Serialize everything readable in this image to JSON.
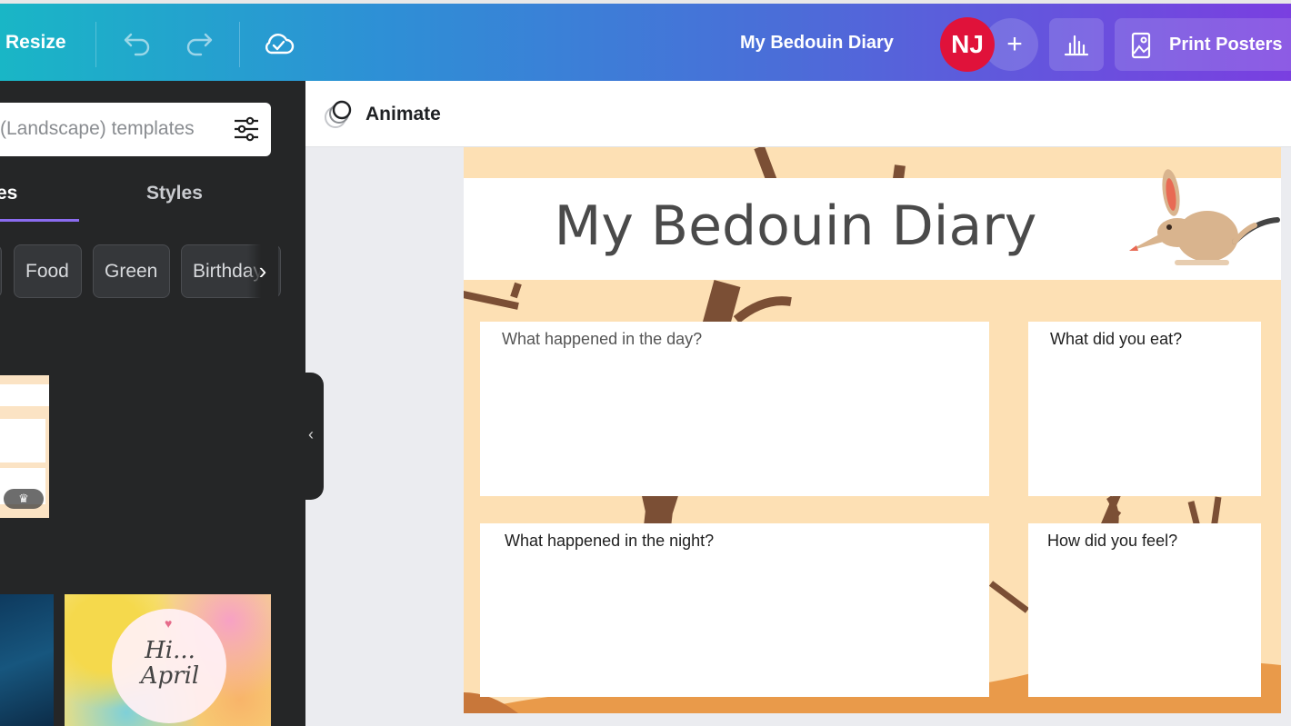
{
  "topbar": {
    "resize_label": "Resize",
    "design_title": "My Bedouin Diary",
    "avatar_initials": "NJ",
    "print_label": "Print Posters"
  },
  "sidebar": {
    "search_placeholder": "(Landscape) templates",
    "tabs": [
      {
        "label": "es"
      },
      {
        "label": "Styles"
      }
    ],
    "chips": [
      {
        "label": "Food"
      },
      {
        "label": "Green"
      },
      {
        "label": "Birthday"
      }
    ],
    "thumb_text": "Hi... April"
  },
  "editor": {
    "animate_label": "Animate"
  },
  "canvas": {
    "title": "My Bedouin Diary",
    "boxes": [
      {
        "label": "What happened in the day?"
      },
      {
        "label": "What did you eat?"
      },
      {
        "label": "What happened in the night?"
      },
      {
        "label": "How did you feel?"
      }
    ]
  },
  "colors": {
    "accent": "#8b6cf0",
    "avatar": "#e0123a",
    "canvas_bg": "#fde0b4",
    "sidebar_bg": "#252627"
  }
}
